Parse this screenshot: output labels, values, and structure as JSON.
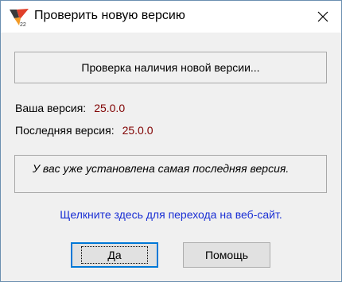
{
  "window": {
    "title": "Проверить новую версию",
    "icon": "app-logo-icon",
    "close_icon": "close-icon"
  },
  "status": {
    "text": "Проверка наличия новой версии..."
  },
  "version": {
    "yours_label": "Ваша версия:",
    "yours_value": "25.0.0",
    "latest_label": "Последняя версия:",
    "latest_value": "25.0.0"
  },
  "message": "У вас уже установлена самая последняя версия.",
  "link": "Щелкните здесь для перехода на веб-сайт.",
  "buttons": {
    "ok": "Да",
    "help": "Помощь"
  },
  "colors": {
    "value": "#800000",
    "link": "#1a2fd4",
    "focus_border": "#0078d7"
  }
}
